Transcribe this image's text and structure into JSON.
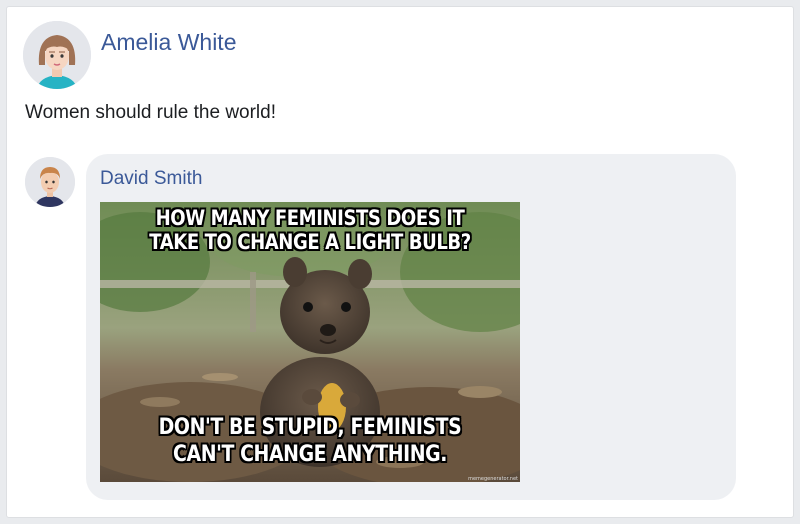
{
  "post": {
    "author": "Amelia White",
    "text": "Women should rule the world!"
  },
  "comment": {
    "author": "David Smith",
    "meme_top_text": "HOW MANY FEMINISTS DOES IT TAKE TO CHANGE A LIGHT BULB?",
    "meme_bottom_text": "DON'T BE STUPID, FEMINISTS CAN'T CHANGE ANYTHING.",
    "meme_watermark": "memegenerator.net"
  },
  "colors": {
    "name_link": "#3b5998",
    "bubble_bg": "#eef0f3"
  }
}
